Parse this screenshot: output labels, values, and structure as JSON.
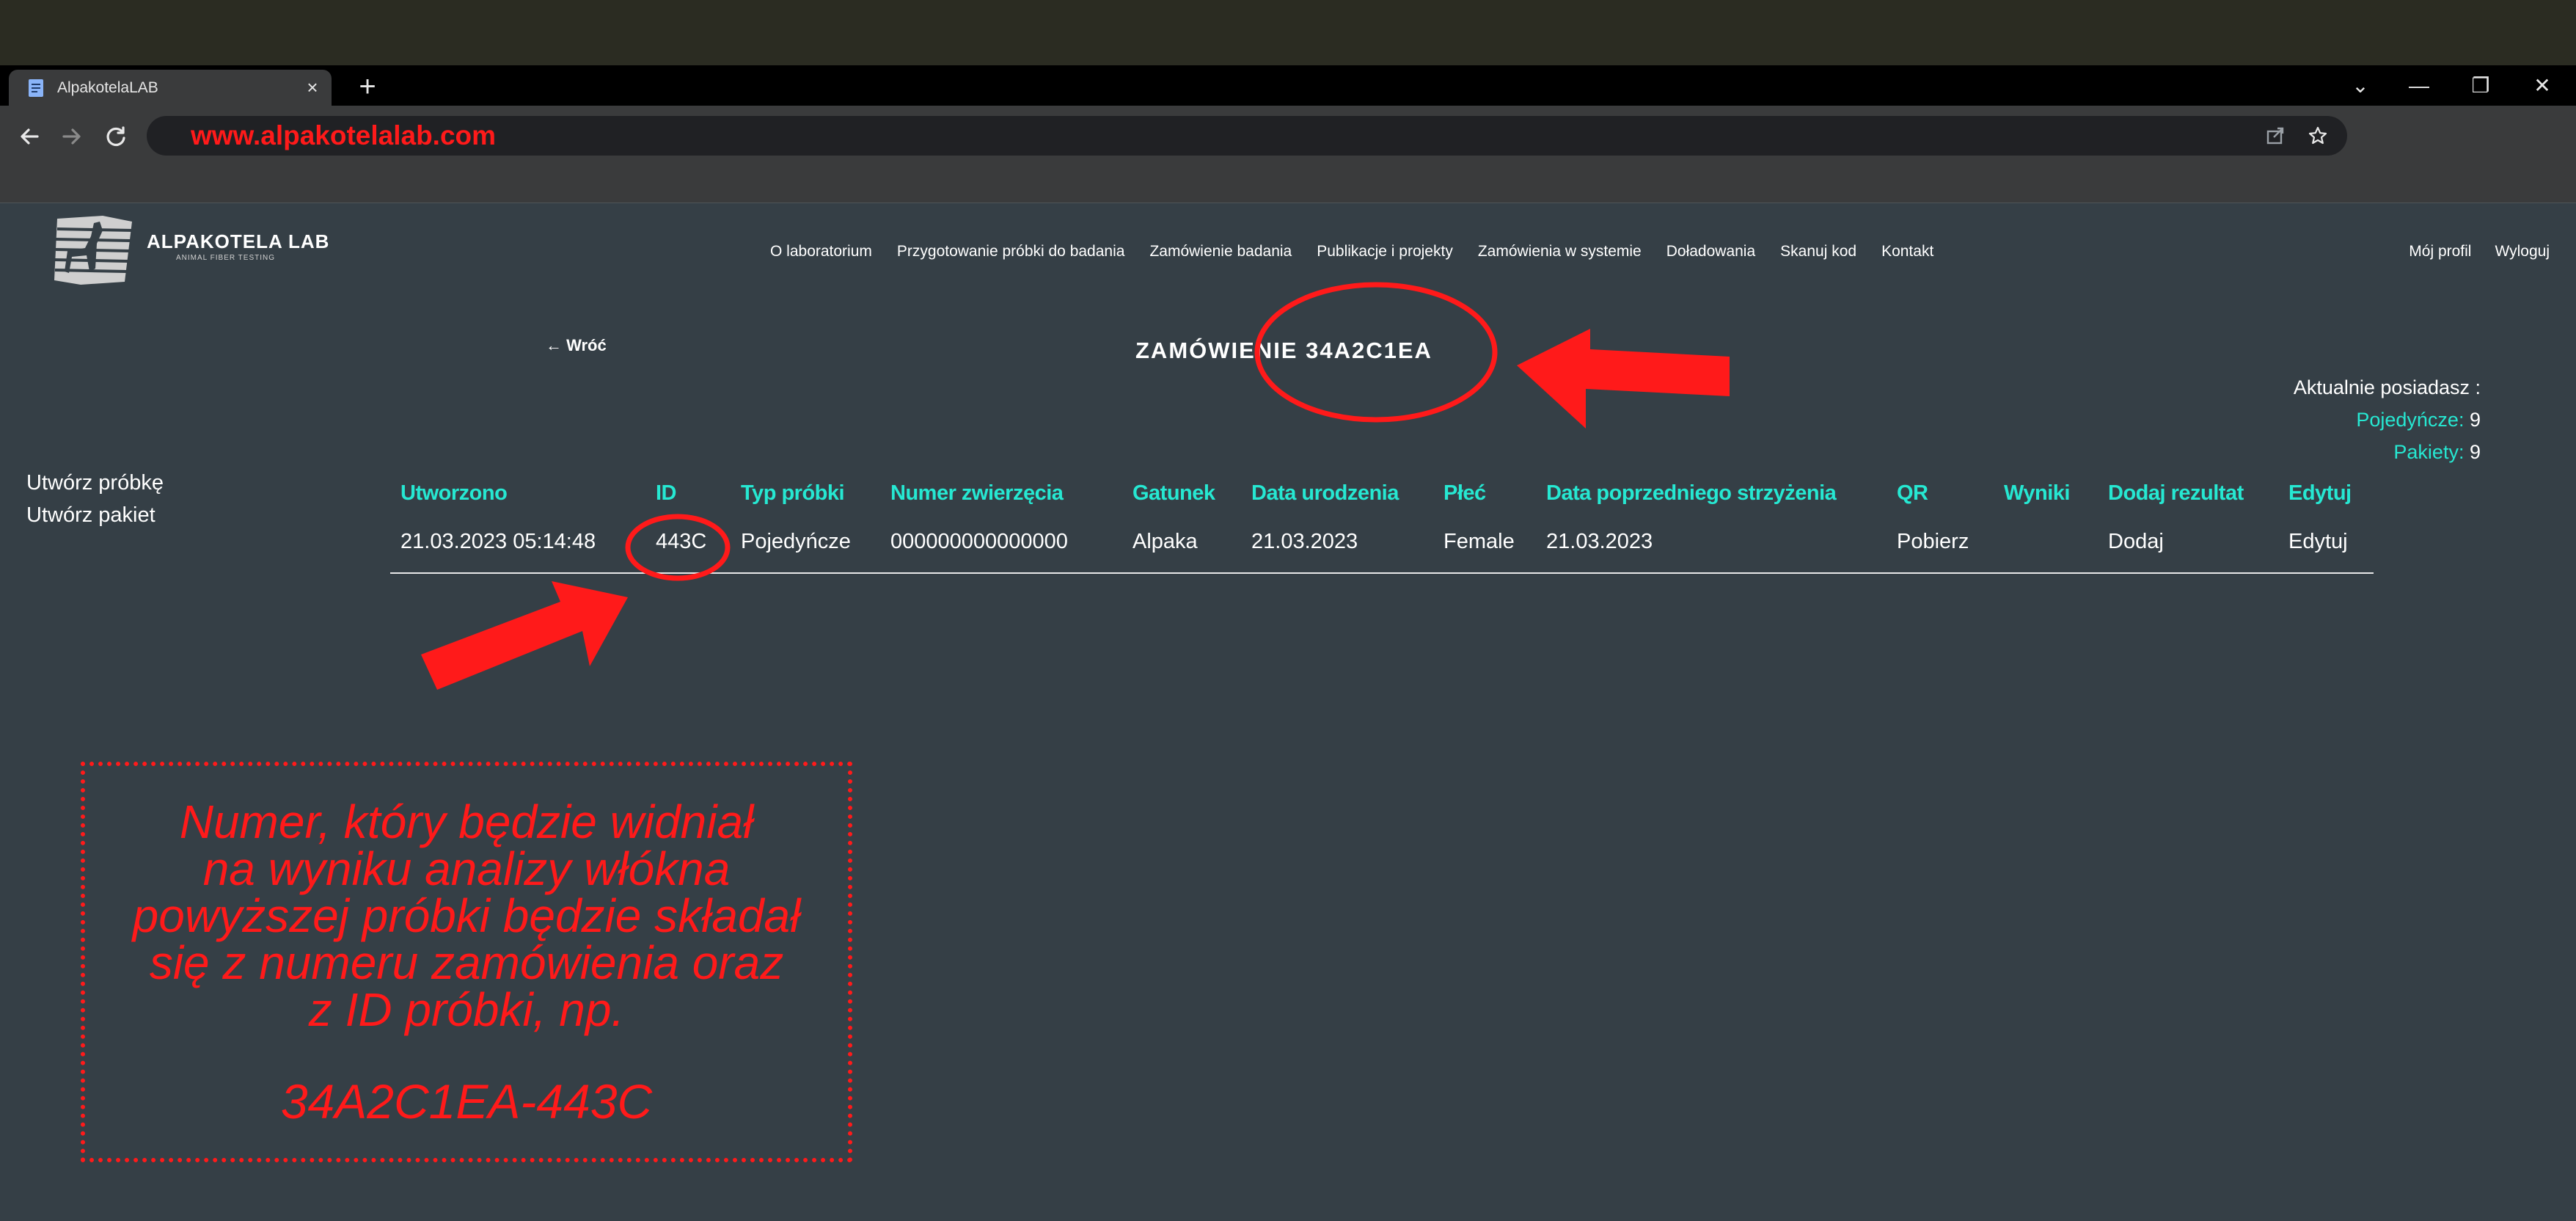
{
  "browser": {
    "tab_title": "AlpakotelaLAB",
    "tab_close": "×",
    "new_tab": "+",
    "url": "www.alpakotelalab.com",
    "window_controls": [
      "⌄",
      "—",
      "❐",
      "✕"
    ]
  },
  "site": {
    "logo_name": "ALPAKOTELA LAB",
    "logo_subtitle": "ANIMAL FIBER TESTING",
    "nav": [
      "O laboratorium",
      "Przygotowanie próbki do badania",
      "Zamówienie badania",
      "Publikacje i projekty",
      "Zamówienia w systemie",
      "Doładowania",
      "Skanuj kod",
      "Kontakt"
    ],
    "user_nav": [
      "Mój profil",
      "Wyloguj"
    ]
  },
  "page": {
    "back_label": "← Wróć",
    "title": "ZAMÓWIENIE 34A2C1EA",
    "balance": {
      "title": "Aktualnie posiadasz :",
      "items": [
        {
          "label": "Pojedyńcze:",
          "value": "9"
        },
        {
          "label": "Pakiety:",
          "value": "9"
        }
      ]
    },
    "sidebar": [
      "Utwórz próbkę",
      "Utwórz pakiet"
    ],
    "table": {
      "headers": [
        "Utworzono",
        "ID",
        "Typ próbki",
        "Numer zwierzęcia",
        "Gatunek",
        "Data urodzenia",
        "Płeć",
        "Data poprzedniego strzyżenia",
        "QR",
        "Wyniki",
        "Dodaj rezultat",
        "Edytuj"
      ],
      "rows": [
        [
          "21.03.2023 05:14:48",
          "443C",
          "Pojedyńcze",
          "000000000000000",
          "Alpaka",
          "21.03.2023",
          "Female",
          "21.03.2023",
          "Pobierz",
          "",
          "Dodaj",
          "Edytuj"
        ]
      ]
    }
  },
  "annotation": {
    "text": "Numer, który będzie widniał\nna wyniku analizy włókna\npowyższej próbki będzie składał\nsię z numeru zamówienia oraz\nz ID próbki, np.",
    "example": "34A2C1EA-443C",
    "color": "#ff1a1a"
  },
  "colors": {
    "page_bg": "#353f46",
    "accent": "#26e8d2",
    "text": "#ffffff"
  }
}
